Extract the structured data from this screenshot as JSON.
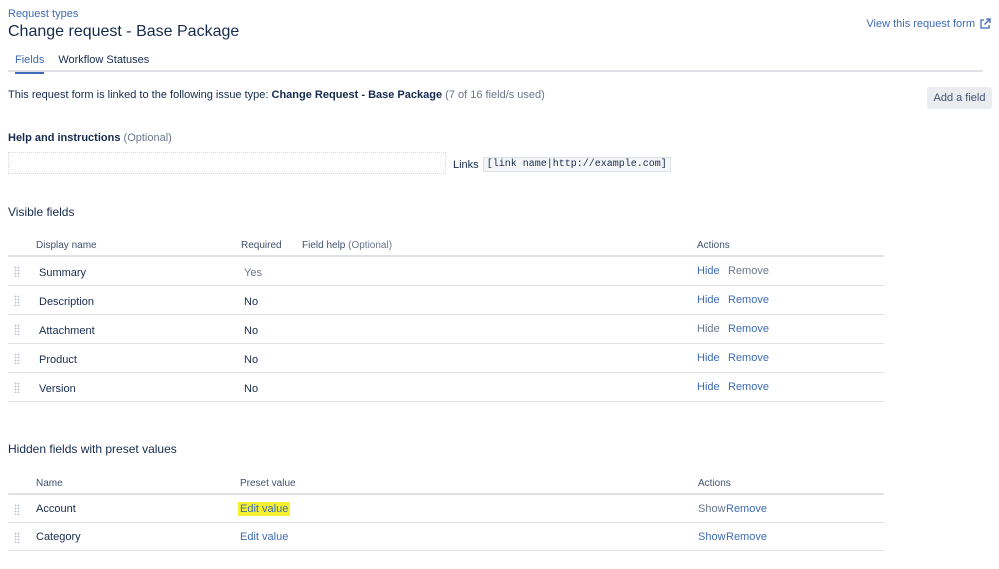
{
  "header": {
    "breadcrumb": "Request types",
    "title": "Change request - Base Package",
    "view_form_link": "View this request form"
  },
  "tabs": [
    {
      "label": "Fields",
      "active": true
    },
    {
      "label": "Workflow Statuses",
      "active": false
    }
  ],
  "linked": {
    "prefix": "This request form is linked to the following issue type: ",
    "issue_type": "Change Request - Base Package",
    "usage": " (7 of 16 field/s used)"
  },
  "add_field_label": "Add a field",
  "help": {
    "label": "Help and instructions",
    "optional": " (Optional)",
    "input_value": "",
    "links_label": "Links",
    "links_code": "[link name|http://example.com]"
  },
  "visible_fields": {
    "title": "Visible fields",
    "headers": {
      "display_name": "Display name",
      "required": "Required",
      "field_help": "Field help",
      "field_help_optional": " (Optional)",
      "actions": "Actions"
    },
    "rows": [
      {
        "name": "Summary",
        "required": "Yes",
        "hide": "Hide",
        "remove": "Remove",
        "hide_enabled": true,
        "remove_enabled": false
      },
      {
        "name": "Description",
        "required": "No",
        "hide": "Hide",
        "remove": "Remove",
        "hide_enabled": true,
        "remove_enabled": true
      },
      {
        "name": "Attachment",
        "required": "No",
        "hide": "Hide",
        "remove": "Remove",
        "hide_enabled": false,
        "remove_enabled": true
      },
      {
        "name": "Product",
        "required": "No",
        "hide": "Hide",
        "remove": "Remove",
        "hide_enabled": true,
        "remove_enabled": true
      },
      {
        "name": "Version",
        "required": "No",
        "hide": "Hide",
        "remove": "Remove",
        "hide_enabled": true,
        "remove_enabled": true
      }
    ]
  },
  "hidden_fields": {
    "title": "Hidden fields with preset values",
    "headers": {
      "name": "Name",
      "preset_value": "Preset value",
      "actions": "Actions"
    },
    "rows": [
      {
        "name": "Account",
        "preset": "Edit value",
        "show": "Show",
        "remove": "Remove",
        "highlighted": true
      },
      {
        "name": "Category",
        "preset": "Edit value",
        "show": "Show",
        "remove": "Remove",
        "highlighted": false
      }
    ]
  },
  "colors": {
    "link": "#3d6bb6",
    "muted": "#6b778c",
    "highlight": "#f6f12f"
  }
}
